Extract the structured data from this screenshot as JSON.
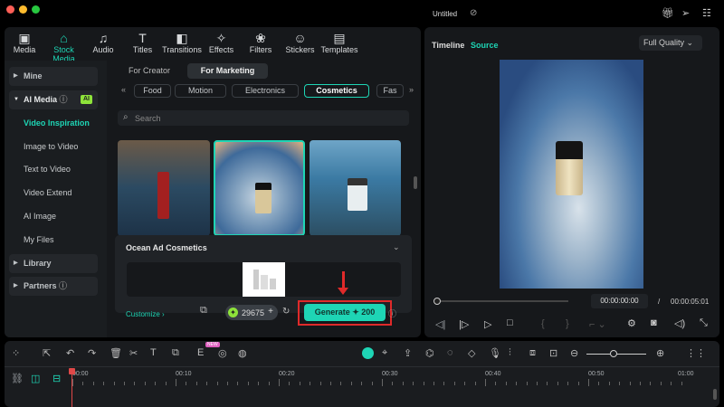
{
  "window": {
    "title": "Untitled"
  },
  "toolbar": [
    {
      "label": "Media",
      "icon": "media-icon"
    },
    {
      "label": "Stock Media",
      "icon": "store-icon"
    },
    {
      "label": "Audio",
      "icon": "music-icon"
    },
    {
      "label": "Titles",
      "icon": "text-icon"
    },
    {
      "label": "Transitions",
      "icon": "transition-icon"
    },
    {
      "label": "Effects",
      "icon": "effects-icon"
    },
    {
      "label": "Filters",
      "icon": "filters-icon"
    },
    {
      "label": "Stickers",
      "icon": "sticker-icon"
    },
    {
      "label": "Templates",
      "icon": "templates-icon"
    }
  ],
  "sidebar": {
    "mine": "Mine",
    "ai_media": "AI Media",
    "ai_badge": "AI",
    "items": [
      "Video Inspiration",
      "Image to Video",
      "Text to Video",
      "Video Extend",
      "AI Image",
      "My Files"
    ],
    "library": "Library",
    "partners": "Partners"
  },
  "tabs": {
    "creator": "For Creator",
    "marketing": "For Marketing"
  },
  "chips": [
    "Food",
    "Motion",
    "Electronics",
    "Cosmetics",
    "Fas"
  ],
  "search": {
    "placeholder": "Search"
  },
  "prompt": {
    "title": "Ocean Ad Cosmetics",
    "customize": "Customize",
    "credits": "29675",
    "generate": "Generate",
    "cost": "200"
  },
  "preview": {
    "timeline_tab": "Timeline",
    "source_tab": "Source",
    "quality": "Full Quality",
    "current_time": "00:00:00:00",
    "separator": "/",
    "total_time": "00:00:05:01",
    "progress": 0
  },
  "timeline": {
    "new_badge": "NEW",
    "ticks": [
      "00:00",
      "00:10",
      "00:20",
      "00:30",
      "00:40",
      "00:50",
      "01:00"
    ]
  },
  "colors": {
    "accent": "#1ed5b5",
    "highlight": "#e02a2a"
  }
}
